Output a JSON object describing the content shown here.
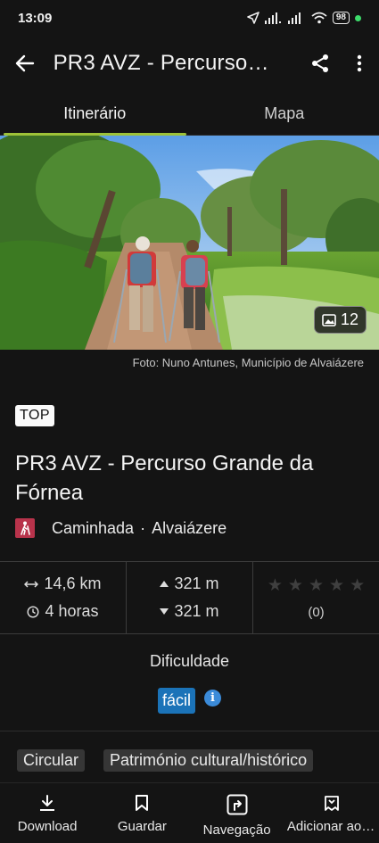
{
  "status_bar": {
    "time": "13:09",
    "battery": "98"
  },
  "header": {
    "title": "PR3 AVZ - Percurso…"
  },
  "tabs": [
    {
      "label": "Itinerário",
      "active": true
    },
    {
      "label": "Mapa",
      "active": false
    }
  ],
  "hero": {
    "photo_count": "12",
    "credit": "Foto: Nuno Antunes, Município de Alvaiázere"
  },
  "route": {
    "badge": "TOP",
    "title": "PR3 AVZ - Percurso Grande da Fórnea",
    "activity": "Caminhada",
    "separator": "·",
    "region": "Alvaiázere"
  },
  "stats": {
    "distance": "14,6 km",
    "duration": "4 horas",
    "ascent": "321 m",
    "descent": "321 m",
    "rating_stars": 0,
    "rating_count": "(0)"
  },
  "difficulty": {
    "label": "Dificuldade",
    "value": "fácil"
  },
  "tags": [
    "Circular",
    "Património cultural/histórico"
  ],
  "bottom_nav": [
    {
      "label": "Download",
      "icon": "download-icon"
    },
    {
      "label": "Guardar",
      "icon": "bookmark-icon"
    },
    {
      "label": "Navegação",
      "icon": "navigation-icon"
    },
    {
      "label": "Adicionar ao …",
      "icon": "add-to-list-icon"
    }
  ],
  "colors": {
    "accent_green": "#9ec238",
    "difficulty_blue": "#1b73b8",
    "activity_red": "#b8334b"
  }
}
